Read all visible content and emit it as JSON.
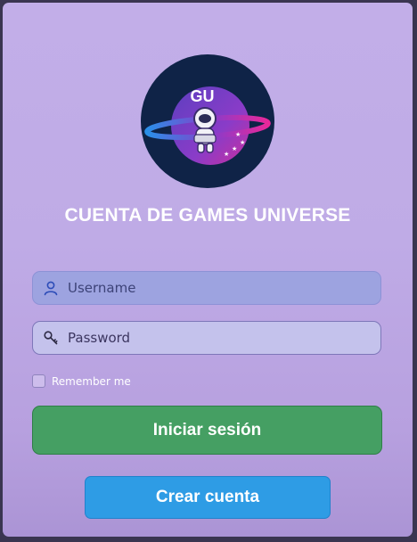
{
  "logo": {
    "text": "GU",
    "icon": "astronaut-logo"
  },
  "title": "CUENTA DE GAMES UNIVERSE",
  "form": {
    "username": {
      "icon": "user-icon",
      "value": "Username"
    },
    "password": {
      "icon": "key-icon",
      "value": "Password"
    },
    "remember_label": "Remember me",
    "remember_checked": false
  },
  "buttons": {
    "login_label": "Iniciar sesión",
    "create_label": "Crear cuenta"
  },
  "colors": {
    "background": "#c2aee8",
    "login_button": "#459f63",
    "create_button": "#2e9ce5",
    "logo_circle": "#0f2347",
    "username_field": "#9da3e0",
    "password_field": "#c4c2ec"
  }
}
